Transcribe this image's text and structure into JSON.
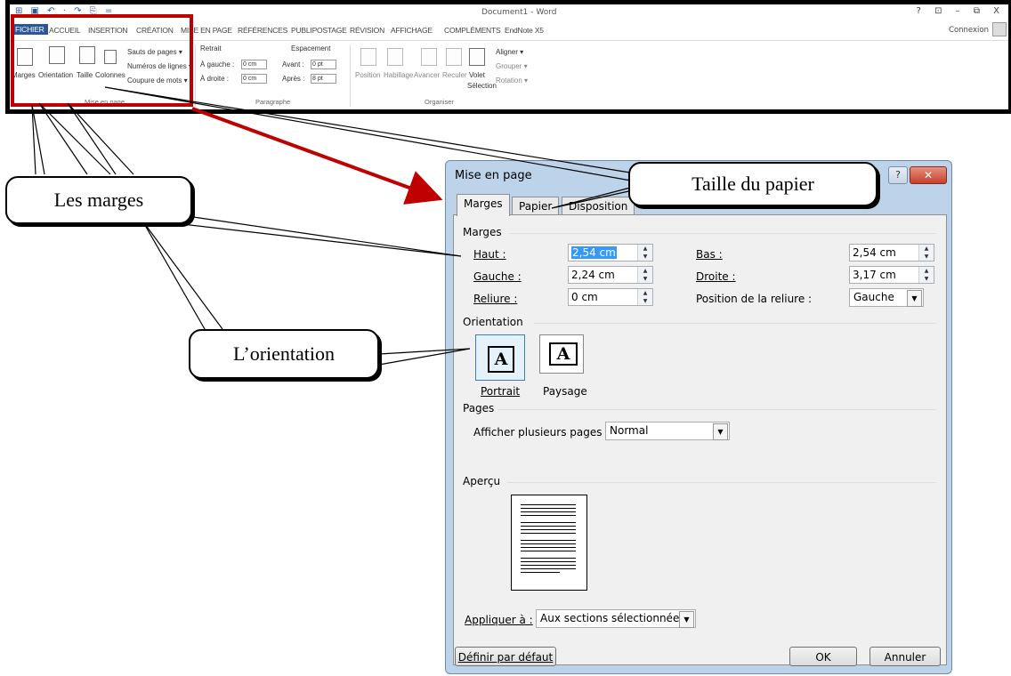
{
  "word": {
    "doc_title": "Document1 - Word",
    "qat": "⊞ ▣ ↶ · ↷ ⎘ =",
    "window_controls": "? ⊡ – ⧉ X",
    "tabs": [
      "FICHIER",
      "ACCUEIL",
      "INSERTION",
      "CRÉATION",
      "MISE EN PAGE",
      "RÉFÉRENCES",
      "PUBLIPOSTAGE",
      "RÉVISION",
      "AFFICHAGE",
      "COMPLÉMENTS",
      "EndNote X5"
    ],
    "connexion": "Connexion",
    "ribbon": {
      "marges": "Marges",
      "orientation": "Orientation",
      "taille": "Taille",
      "colonnes": "Colonnes",
      "sauts": "Sauts de pages ▾",
      "numeros": "Numéros de lignes ▾",
      "coupure": "Coupure de mots ▾",
      "group_mise_en_page": "Mise en page",
      "retrait": "Retrait",
      "a_gauche": "À gauche :",
      "a_droite": "À droite :",
      "retrait_val1": "0 cm",
      "retrait_val2": "0 cm",
      "espacement": "Espacement",
      "avant": "Avant :",
      "apres": "Après :",
      "avant_val": "0 pt",
      "apres_val": "8 pt",
      "group_paragraphe": "Paragraphe",
      "position": "Position",
      "habillage": "Habillage",
      "avancer": "Avancer",
      "reculer": "Reculer",
      "volet": "Volet",
      "selection": "Sélection",
      "aligner": "Aligner ▾",
      "grouper": "Grouper ▾",
      "rotation": "Rotation ▾",
      "group_organiser": "Organiser"
    }
  },
  "dialog": {
    "title": "Mise en page",
    "help": "?",
    "close": "✕",
    "tabs": [
      "Marges",
      "Papier",
      "Disposition"
    ],
    "margins_section": "Marges",
    "haut_label": "Haut :",
    "haut_value": "2,54 cm",
    "bas_label": "Bas :",
    "bas_value": "2,54 cm",
    "gauche_label": "Gauche :",
    "gauche_value": "2,24 cm",
    "droite_label": "Droite :",
    "droite_value": "3,17 cm",
    "reliure_label": "Reliure :",
    "reliure_value": "0 cm",
    "pos_reliure_label": "Position de la reliure :",
    "pos_reliure_value": "Gauche",
    "orientation_section": "Orientation",
    "portrait": "Portrait",
    "paysage": "Paysage",
    "pages_section": "Pages",
    "plusieurs_label": "Afficher plusieurs pages :",
    "plusieurs_value": "Normal",
    "apercu_section": "Aperçu",
    "appliquer_label": "Appliquer à :",
    "appliquer_value": "Aux sections sélectionnées",
    "definir": "Définir par défaut",
    "ok": "OK",
    "annuler": "Annuler"
  },
  "callouts": {
    "taille": "Taille du papier",
    "marges": "Les marges",
    "orientation": "L’orientation"
  },
  "colors": {
    "highlight_red": "#c00000",
    "word_blue": "#2b579a",
    "dialog_frame": "#bcd3ea",
    "selection_blue": "#3399ff"
  }
}
